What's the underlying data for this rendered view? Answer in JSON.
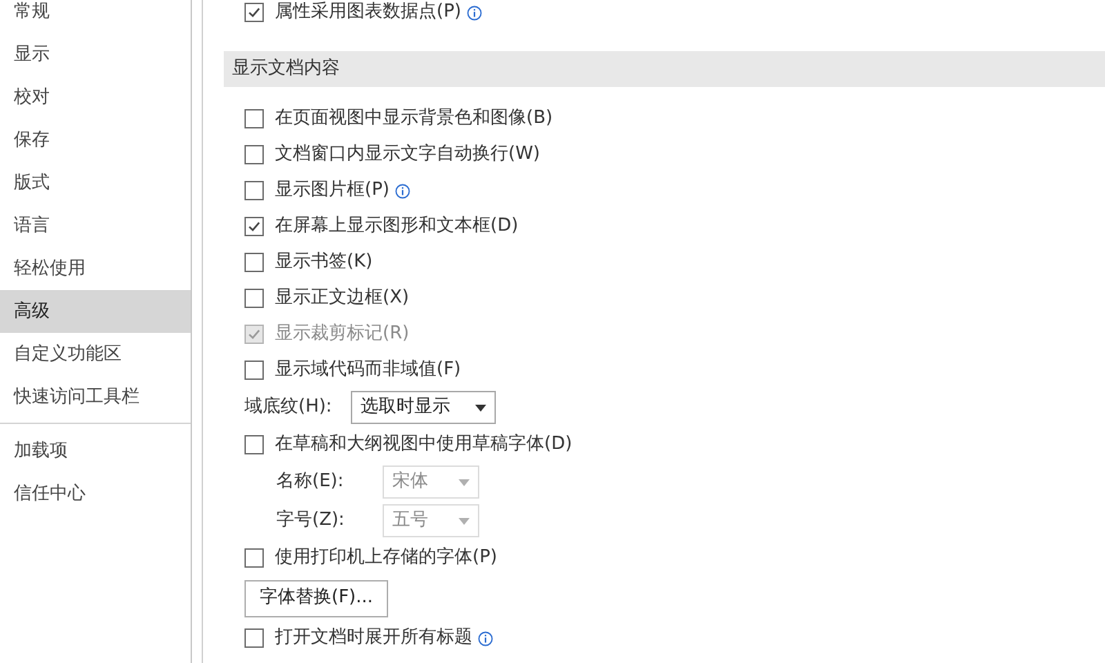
{
  "sidebar": {
    "sections": [
      {
        "items": [
          {
            "label": "常规",
            "selected": false
          },
          {
            "label": "显示",
            "selected": false
          },
          {
            "label": "校对",
            "selected": false
          },
          {
            "label": "保存",
            "selected": false
          },
          {
            "label": "版式",
            "selected": false
          },
          {
            "label": "语言",
            "selected": false
          },
          {
            "label": "轻松使用",
            "selected": false
          },
          {
            "label": "高级",
            "selected": true
          },
          {
            "label": "自定义功能区",
            "selected": false
          },
          {
            "label": "快速访问工具栏",
            "selected": false
          }
        ]
      },
      {
        "items": [
          {
            "label": "加载项",
            "selected": false
          },
          {
            "label": "信任中心",
            "selected": false
          }
        ]
      }
    ]
  },
  "top_options": [
    {
      "kind": "checkbox",
      "label": "属性采用图表数据点(P)",
      "checked": true,
      "disabled": false,
      "info": true
    }
  ],
  "sections": [
    {
      "title": "显示文档内容",
      "options": [
        {
          "kind": "checkbox",
          "label": "在页面视图中显示背景色和图像(B)",
          "checked": false,
          "disabled": false,
          "info": false
        },
        {
          "kind": "checkbox",
          "label": "文档窗口内显示文字自动换行(W)",
          "checked": false,
          "disabled": false,
          "info": false
        },
        {
          "kind": "checkbox",
          "label": "显示图片框(P)",
          "checked": false,
          "disabled": false,
          "info": true
        },
        {
          "kind": "checkbox",
          "label": "在屏幕上显示图形和文本框(D)",
          "checked": true,
          "disabled": false,
          "info": false
        },
        {
          "kind": "checkbox",
          "label": "显示书签(K)",
          "checked": false,
          "disabled": false,
          "info": false
        },
        {
          "kind": "checkbox",
          "label": "显示正文边框(X)",
          "checked": false,
          "disabled": false,
          "info": false
        },
        {
          "kind": "checkbox",
          "label": "显示裁剪标记(R)",
          "checked": true,
          "disabled": true,
          "info": false
        },
        {
          "kind": "checkbox",
          "label": "显示域代码而非域值(F)",
          "checked": false,
          "disabled": false,
          "info": false
        },
        {
          "kind": "dropdown",
          "label": "域底纹(H):",
          "value": "选取时显示",
          "disabled": false
        },
        {
          "kind": "checkbox",
          "label": "在草稿和大纲视图中使用草稿字体(D)",
          "checked": false,
          "disabled": false,
          "info": false,
          "children": [
            {
              "kind": "dropdown",
              "label": "名称(E):",
              "value": "宋体",
              "disabled": true
            },
            {
              "kind": "dropdown",
              "label": "字号(Z):",
              "value": "五号",
              "disabled": true
            }
          ]
        },
        {
          "kind": "checkbox",
          "label": "使用打印机上存储的字体(P)",
          "checked": false,
          "disabled": false,
          "info": false
        },
        {
          "kind": "button",
          "label": "字体替换(F)..."
        },
        {
          "kind": "checkbox",
          "label": "打开文档时展开所有标题",
          "checked": false,
          "disabled": false,
          "info": true
        }
      ]
    }
  ]
}
